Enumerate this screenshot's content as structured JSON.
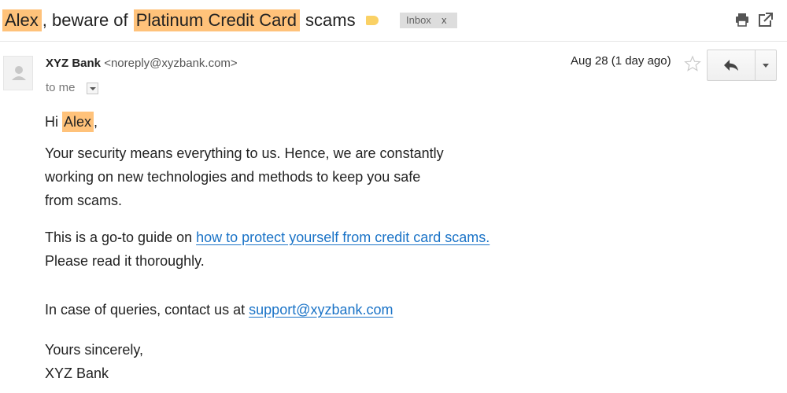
{
  "subject": {
    "name_highlight": "Alex",
    "part1": ", beware of ",
    "card_highlight": "Platinum Credit Card",
    "part2": " scams",
    "label": "Inbox",
    "label_close": "x"
  },
  "message": {
    "sender_name": "XYZ Bank",
    "sender_email": "<noreply@xyzbank.com>",
    "to": "to me",
    "date": "Aug 28 (1 day ago)"
  },
  "body": {
    "greeting_prefix": "Hi ",
    "greeting_name": "Alex",
    "greeting_suffix": ",",
    "para1_line1": "Your security means everything to us. Hence, we are constantly",
    "para1_line2": "working on new technologies and methods to keep you safe",
    "para1_line3": "from scams.",
    "para2_prefix": "This is a go-to guide on ",
    "para2_link": "how to protect yourself from credit card scams.",
    "para2_line2": "Please read it thoroughly.",
    "para3_prefix": "In case of queries, contact us at ",
    "para3_link": "support@xyzbank.com",
    "closing_line1": "Yours sincerely,",
    "closing_line2": "XYZ Bank"
  },
  "icons": {
    "print": "print-icon",
    "new_window": "new-window-icon",
    "star": "star-icon",
    "reply": "reply-icon",
    "more": "chevron-down-icon",
    "avatar": "avatar-icon",
    "label_tag": "label-tag-icon"
  },
  "colors": {
    "highlight": "#ffc27a",
    "link": "#1a73c7",
    "label_tag": "#fad165",
    "label_bg": "#dddddd"
  }
}
